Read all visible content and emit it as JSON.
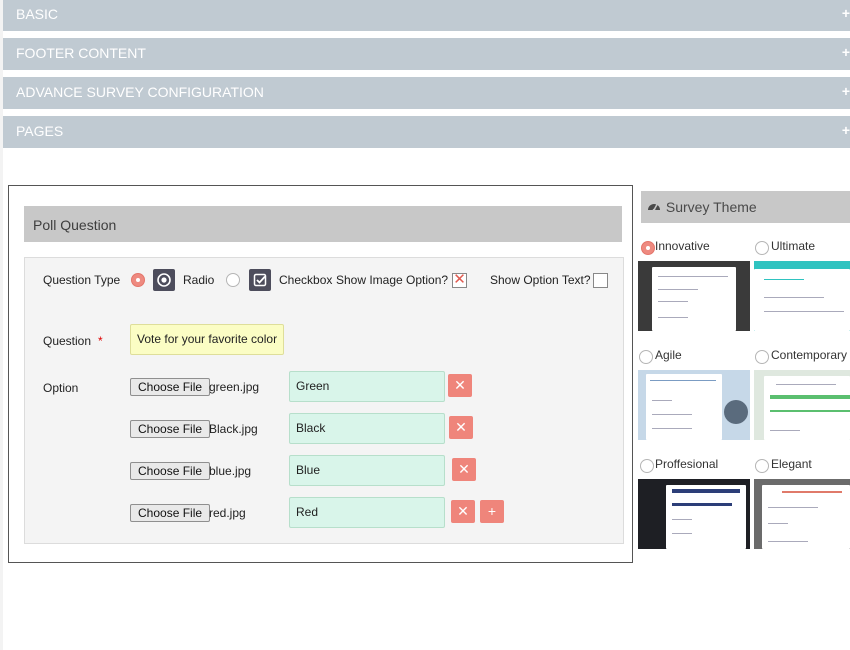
{
  "accordion": [
    {
      "label": "BASIC",
      "icon": "+"
    },
    {
      "label": "FOOTER CONTENT",
      "icon": "+"
    },
    {
      "label": "ADVANCE SURVEY CONFIGURATION",
      "icon": "+"
    },
    {
      "label": "PAGES",
      "icon": "+"
    }
  ],
  "poll": {
    "header": "Poll Question",
    "question_type_label": "Question Type",
    "radio_label": "Radio",
    "checkbox_label": "Checkbox",
    "question_type_selected": "Radio",
    "show_image_label": "Show Image Option?",
    "show_image_checked": true,
    "show_image_mark": "✕",
    "show_text_label": "Show Option Text?",
    "show_text_checked": false,
    "question_label": "Question",
    "required_mark": "*",
    "question_value": "Vote for your favorite color",
    "option_label": "Option",
    "choose_file_label": "Choose File",
    "remove_icon": "✕",
    "add_icon": "+",
    "options": [
      {
        "file": "green.jpg",
        "text": "Green"
      },
      {
        "file": "Black.jpg",
        "text": "Black"
      },
      {
        "file": "blue.jpg",
        "text": "Blue"
      },
      {
        "file": "red.jpg",
        "text": "Red"
      }
    ]
  },
  "theme": {
    "title": "Survey Theme",
    "selected": "Innovative",
    "options": [
      {
        "name": "Innovative",
        "selected": true
      },
      {
        "name": "Ultimate",
        "selected": false
      },
      {
        "name": "Agile",
        "selected": false
      },
      {
        "name": "Contemporary",
        "selected": false
      },
      {
        "name": "Proffesional",
        "selected": false
      },
      {
        "name": "Elegant",
        "selected": false
      }
    ]
  },
  "colors": {
    "accordion_bg": "#c0cad2",
    "accent": "#ef857b",
    "option_input_bg": "#d9f5ea",
    "question_input_bg": "#fbfdc4"
  }
}
